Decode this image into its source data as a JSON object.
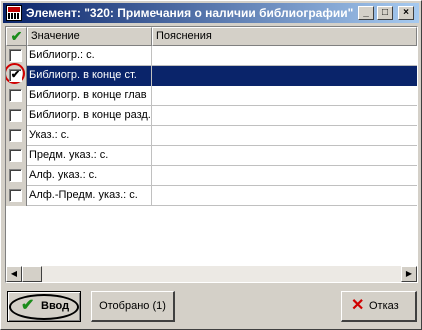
{
  "window": {
    "title": "Элемент: \"320: Примечания о наличии библиографии\"",
    "minimize_glyph": "_",
    "maximize_glyph": "□",
    "close_glyph": "×"
  },
  "grid": {
    "header_check_glyph": "✔",
    "columns": [
      "Значение",
      "Пояснения"
    ],
    "rows": [
      {
        "value": "Библиогр.: с.",
        "note": "",
        "checked": false,
        "selected": false
      },
      {
        "value": "Библиогр. в конце ст.",
        "note": "",
        "checked": true,
        "selected": true
      },
      {
        "value": "Библиогр. в конце глав",
        "note": "",
        "checked": false,
        "selected": false
      },
      {
        "value": "Библиогр. в конце разд.",
        "note": "",
        "checked": false,
        "selected": false
      },
      {
        "value": "Указ.: с.",
        "note": "",
        "checked": false,
        "selected": false
      },
      {
        "value": "Предм. указ.: с.",
        "note": "",
        "checked": false,
        "selected": false
      },
      {
        "value": "Алф. указ.: с.",
        "note": "",
        "checked": false,
        "selected": false
      },
      {
        "value": "Алф.-Предм. указ.: с.",
        "note": "",
        "checked": false,
        "selected": false
      }
    ],
    "check_glyph": "✔",
    "scroll_left_glyph": "◀",
    "scroll_right_glyph": "▶"
  },
  "buttons": {
    "ok_icon": "✔",
    "ok_label": "Ввод",
    "selected_label": "Отобрано (1)",
    "cancel_icon": "✕",
    "cancel_label": "Отказ"
  },
  "colors": {
    "selection": "#0a246a",
    "highlight_ring": "#d00000",
    "check_green": "#1a8c1a"
  }
}
